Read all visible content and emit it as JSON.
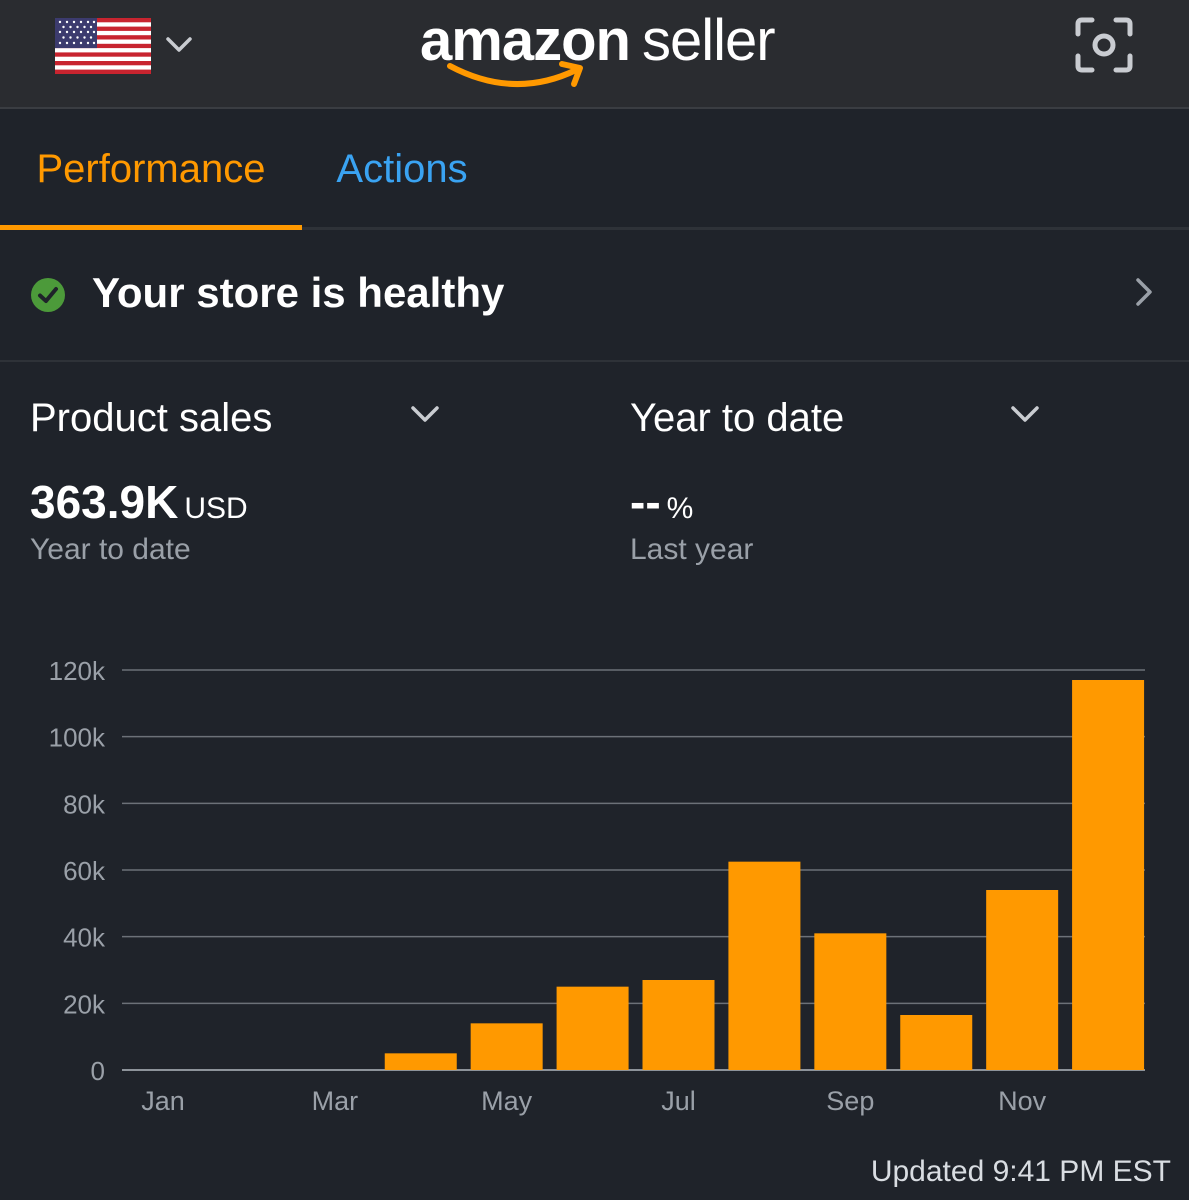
{
  "header": {
    "country": "United States",
    "logo_amazon": "amazon",
    "logo_seller": "seller",
    "icons": [
      "us-flag-icon",
      "chevron-down-icon",
      "camera-scan-icon"
    ]
  },
  "tabs": [
    {
      "label": "Performance",
      "active": true
    },
    {
      "label": "Actions",
      "active": false
    }
  ],
  "health": {
    "text": "Your store is healthy",
    "status": "healthy"
  },
  "metric": {
    "selector_label": "Product sales",
    "value": "363.9K",
    "unit": "USD",
    "caption": "Year to date"
  },
  "comparison": {
    "selector_label": "Year to date",
    "value": "--",
    "unit": "%",
    "caption": "Last year"
  },
  "colors": {
    "accent": "#ff9900",
    "link": "#3aa3f2",
    "background": "#1f232a",
    "healthy": "#4c9a3a"
  },
  "chart_data": {
    "type": "bar",
    "categories": [
      "Jan",
      "Feb",
      "Mar",
      "Apr",
      "May",
      "Jun",
      "Jul",
      "Aug",
      "Sep",
      "Oct",
      "Nov",
      "Dec"
    ],
    "x_tick_labels": [
      "Jan",
      "Mar",
      "May",
      "Jul",
      "Sep",
      "Nov"
    ],
    "values": [
      0,
      0,
      0,
      5000,
      14000,
      25000,
      27000,
      62500,
      41000,
      16500,
      54000,
      117000
    ],
    "y_ticks": [
      0,
      20000,
      40000,
      60000,
      80000,
      100000,
      120000
    ],
    "y_tick_labels": [
      "0",
      "20k",
      "40k",
      "60k",
      "80k",
      "100k",
      "120k"
    ],
    "ylim": [
      0,
      120000
    ],
    "grid": true,
    "title": "",
    "xlabel": "",
    "ylabel": ""
  },
  "footer": {
    "updated": "Updated 9:41 PM EST"
  }
}
